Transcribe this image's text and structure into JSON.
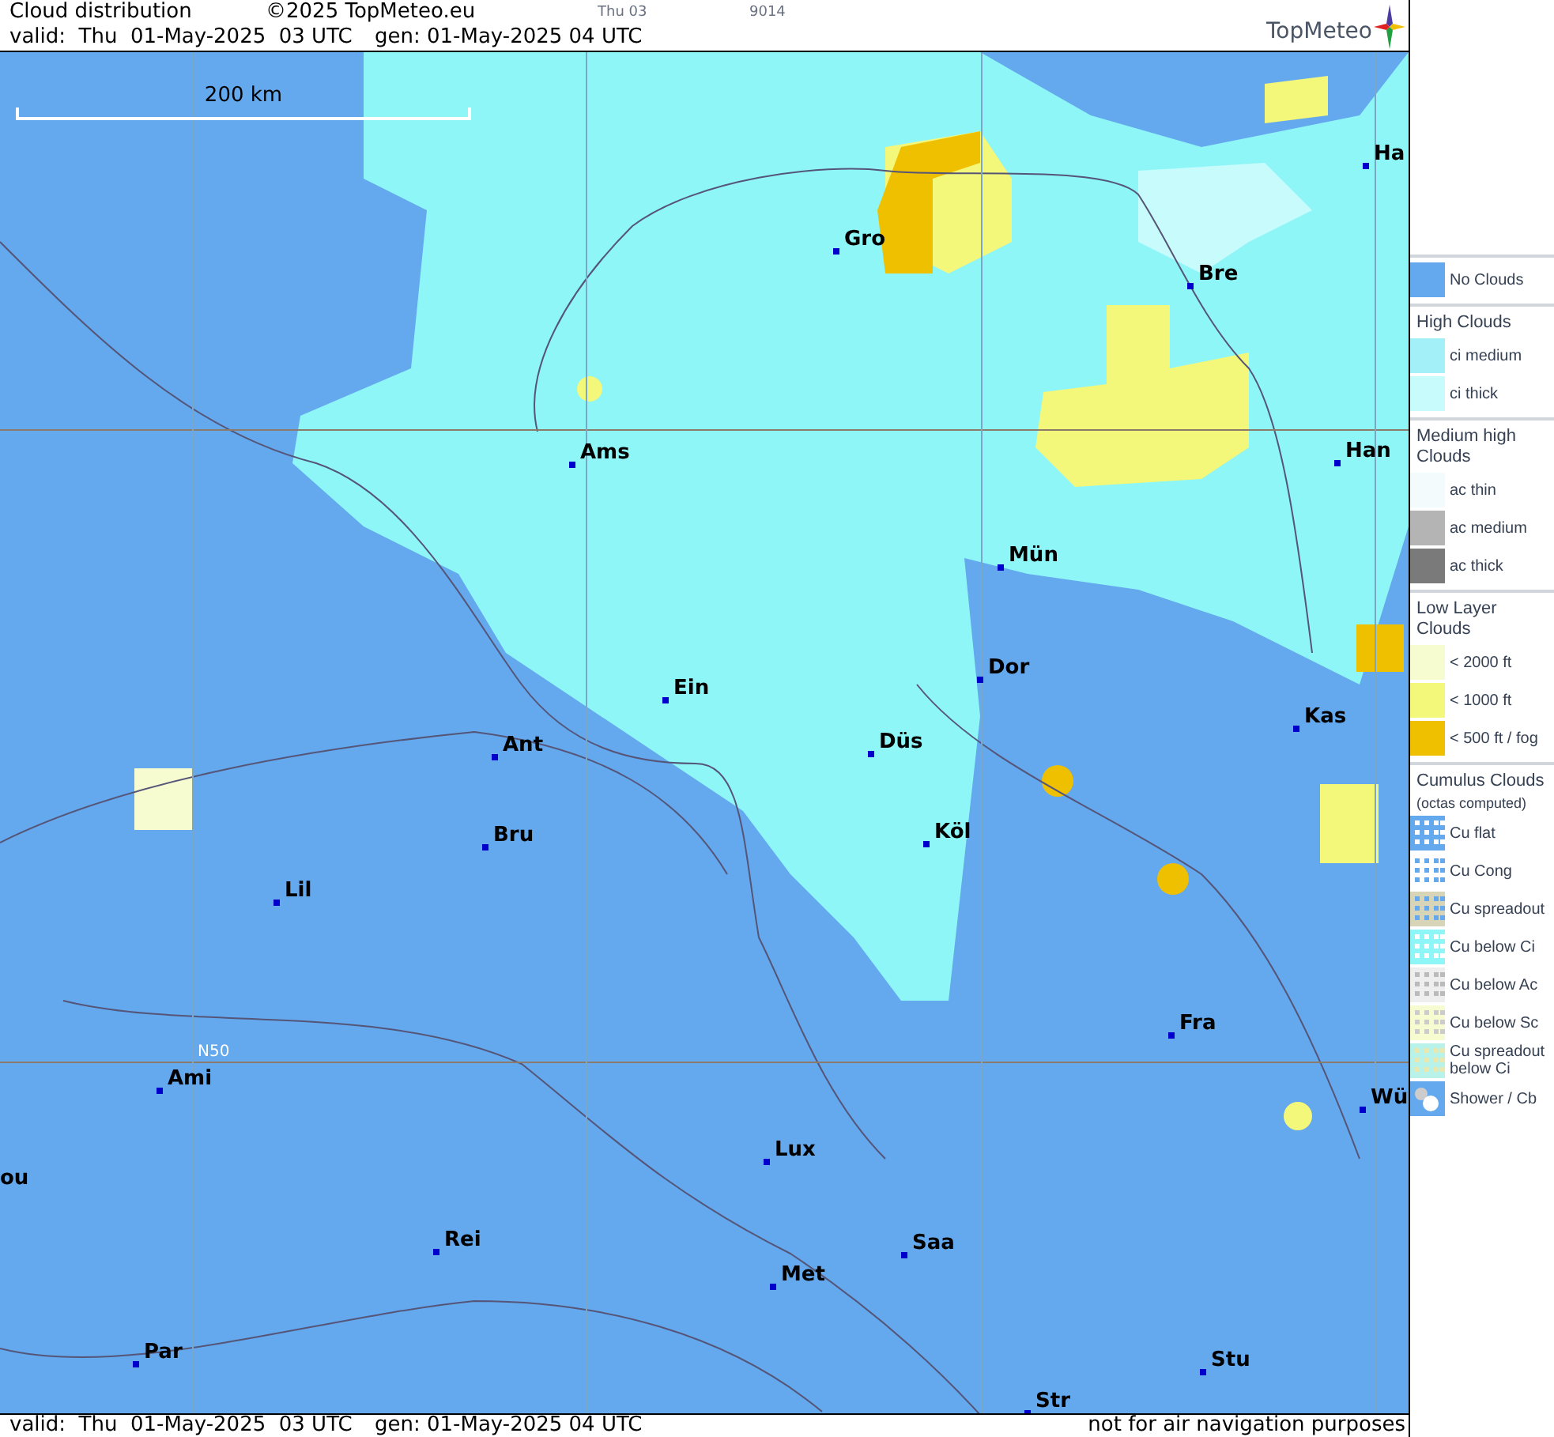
{
  "header": {
    "title": "Cloud distribution",
    "copyright": "©2025 TopMeteo.eu",
    "day": "Thu 03",
    "code": "9014",
    "valid": "valid:  Thu  01-May-2025  03 UTC",
    "gen": "gen: 01-May-2025 04 UTC",
    "logo": "TopMeteo"
  },
  "map": {
    "scale": "200 km",
    "grid_label": "N50",
    "cities": [
      {
        "name": "Ha"
      },
      {
        "name": "Gro"
      },
      {
        "name": "Bre"
      },
      {
        "name": "Ams"
      },
      {
        "name": "Han"
      },
      {
        "name": "Mün"
      },
      {
        "name": "Dor"
      },
      {
        "name": "Ein"
      },
      {
        "name": "Kas"
      },
      {
        "name": "Düs"
      },
      {
        "name": "Ant"
      },
      {
        "name": "Köl"
      },
      {
        "name": "Bru"
      },
      {
        "name": "Lil"
      },
      {
        "name": "Fra"
      },
      {
        "name": "Ami"
      },
      {
        "name": "Wü"
      },
      {
        "name": "Lux"
      },
      {
        "name": "ou"
      },
      {
        "name": "Rei"
      },
      {
        "name": "Saa"
      },
      {
        "name": "Met"
      },
      {
        "name": "Stu"
      },
      {
        "name": "Par"
      },
      {
        "name": "Str"
      }
    ]
  },
  "legend": [
    {
      "items": [
        {
          "label": "No Clouds",
          "kind": "none"
        }
      ]
    },
    {
      "title": "High Clouds",
      "items": [
        {
          "label": "ci medium",
          "kind": "ci_medium"
        },
        {
          "label": "ci thick",
          "kind": "ci_thick"
        }
      ]
    },
    {
      "title": "Medium high Clouds",
      "items": [
        {
          "label": "ac thin",
          "kind": "ac_thin"
        },
        {
          "label": "ac medium",
          "kind": "ac_medium"
        },
        {
          "label": "ac thick",
          "kind": "ac_thick"
        }
      ]
    },
    {
      "title": "Low Layer Clouds",
      "items": [
        {
          "label": "< 2000 ft",
          "kind": "low_2000"
        },
        {
          "label": "< 1000 ft",
          "kind": "low_1000"
        },
        {
          "label": "< 500 ft / fog",
          "kind": "low_500"
        }
      ]
    },
    {
      "title": "Cumulus Clouds",
      "subtitle": "(octas computed)",
      "items": [
        {
          "label": "Cu flat",
          "kind": "cu_flat"
        },
        {
          "label": "Cu Cong",
          "kind": "cu_cong"
        },
        {
          "label": "Cu spreadout",
          "kind": "cu_spread"
        },
        {
          "label": "Cu below Ci",
          "kind": "cu_ci"
        },
        {
          "label": "Cu below Ac",
          "kind": "cu_ac"
        },
        {
          "label": "Cu below Sc",
          "kind": "cu_sc"
        },
        {
          "label": "Cu spreadout below Ci",
          "kind": "cu_spread_ci"
        },
        {
          "label": "Shower / Cb",
          "kind": "shower"
        }
      ]
    }
  ],
  "footer": {
    "valid": "valid:  Thu  01-May-2025  03 UTC",
    "gen": "gen: 01-May-2025 04 UTC",
    "disclaimer": "not for air navigation purposes"
  }
}
